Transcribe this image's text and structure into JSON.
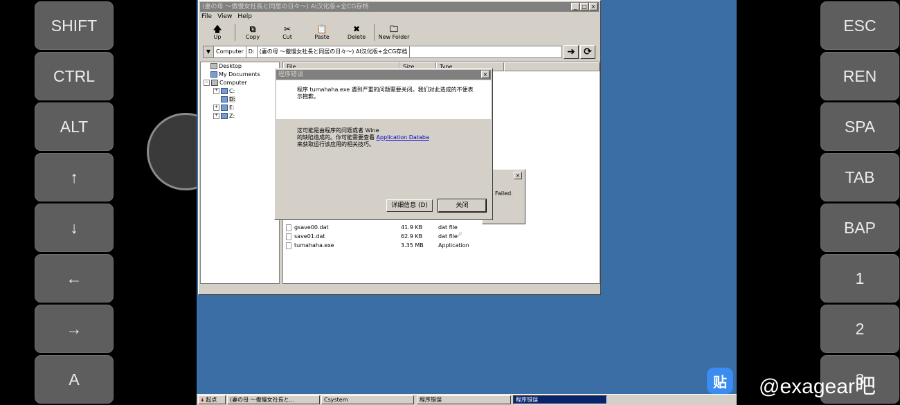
{
  "left_keys": [
    "SHIFT",
    "CTRL",
    "ALT",
    "↑",
    "↓",
    "←",
    "→",
    "A"
  ],
  "right_keys": [
    "ESC",
    "REN",
    "SPA",
    "TAB",
    "BAP",
    "1",
    "2",
    "3"
  ],
  "explorer": {
    "title": "(妻の母 ～傲慢女社長と同居の日々～) AI汉化版+全CG存档",
    "menu": [
      "File",
      "View",
      "Help"
    ],
    "toolbar": [
      {
        "label": "Up",
        "glyph": "🡅"
      },
      {
        "label": "Copy",
        "glyph": "⧉"
      },
      {
        "label": "Cut",
        "glyph": "✂"
      },
      {
        "label": "Paste",
        "glyph": "📋"
      },
      {
        "label": "Delete",
        "glyph": "✖"
      },
      {
        "label": "New Folder",
        "glyph": "🗀"
      }
    ],
    "address": [
      "Computer",
      "D:",
      "(妻の母 ～傲慢女社長と同居の日々～) AI汉化版+全CG存档"
    ],
    "tree": {
      "desktop": "Desktop",
      "documents": "My Documents",
      "computer": "Computer",
      "drives": [
        "C:",
        "D:",
        "E:",
        "Z:"
      ]
    },
    "columns": [
      "File",
      "Size",
      "Type"
    ],
    "files": [
      {
        "name": "gsave00.dat",
        "size": "41.9 KB",
        "type": "dat file"
      },
      {
        "name": "save01.dat",
        "size": "62.9 KB",
        "type": "dat file"
      },
      {
        "name": "tumahaha.exe",
        "size": "3.35 MB",
        "type": "Application"
      }
    ]
  },
  "small_dialog": {
    "text": "Failed."
  },
  "error_dialog": {
    "title": "程序错误",
    "message": "程序 tumahaha.exe 遇到严重的问题需要关闭。我们对此造成的不便表示抱歉。",
    "info_line1": "这可能是由程序的问题或者 Wine",
    "info_line2": "的缺陷造成的。你可能需要查看",
    "info_link": "Application Databa",
    "info_line3": "来获取运行该应用的相关技巧。",
    "details_button": "详细信息 (D)",
    "close_button": "关闭"
  },
  "taskbar": {
    "start": "起点",
    "items": [
      "(妻の母 ～傲慢女社長と...",
      "Csystem",
      "程序错误",
      "程序错误"
    ]
  },
  "watermark": "@exagear吧",
  "tieba_logo": "贴"
}
